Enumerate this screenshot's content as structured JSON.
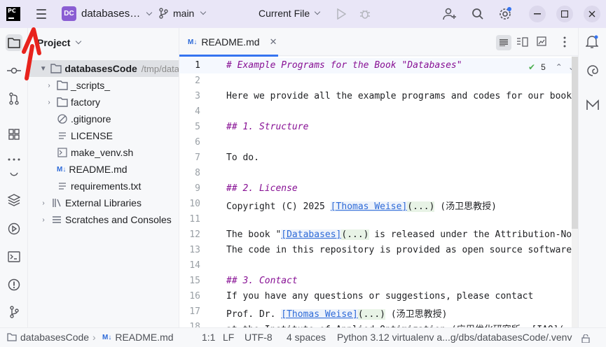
{
  "titlebar": {
    "logo_text": "PC",
    "project_badge": "DC",
    "project_name": "databases…",
    "branch": "main",
    "run_config": "Current File"
  },
  "project_panel": {
    "title": "Project",
    "root": {
      "name": "databasesCode",
      "path": "/tmp/data"
    },
    "items": [
      {
        "label": "_scripts_",
        "type": "folder"
      },
      {
        "label": "factory",
        "type": "folder"
      },
      {
        "label": ".gitignore",
        "type": "ignore"
      },
      {
        "label": "LICENSE",
        "type": "text"
      },
      {
        "label": "make_venv.sh",
        "type": "shell"
      },
      {
        "label": "README.md",
        "type": "markdown"
      },
      {
        "label": "requirements.txt",
        "type": "text"
      }
    ],
    "external_libraries": "External Libraries",
    "scratches": "Scratches and Consoles"
  },
  "editor": {
    "tab_label": "README.md",
    "tab_badge": "M↓",
    "inspection_count": "5",
    "line_numbers": [
      "1",
      "2",
      "3",
      "4",
      "5",
      "6",
      "7",
      "8",
      "9",
      "10",
      "11",
      "12",
      "13",
      "14",
      "15",
      "16",
      "17",
      "18"
    ],
    "lines": {
      "l1": "# Example Programs for the Book \"Databases\"",
      "l3": "Here we provide all the example programs and codes for our book",
      "l5": "## 1. Structure",
      "l7": "To do.",
      "l9": "## 2. License",
      "l10_a": "Copyright (C) 2025 ",
      "l10_link": "[Thomas Weise]",
      "l10_dots": "(...)",
      "l10_b": " (汤卫思教授)",
      "l12_a": "The book \"",
      "l12_link": "[Databases]",
      "l12_dots": "(...)",
      "l12_b": " is released under the Attribution-No",
      "l13": "The code in this repository is provided as open source software",
      "l15": "## 3. Contact",
      "l16": "If you have any questions or suggestions, please contact",
      "l17_a": "Prof. Dr. ",
      "l17_link": "[Thomas Weise]",
      "l17_dots": "(...)",
      "l17_b": " (汤卫思教授)",
      "l18": "at the Institute of Applied Optimization (应用优化研究所, [IAO]("
    }
  },
  "statusbar": {
    "project": "databasesCode",
    "file": "README.md",
    "file_badge": "M↓",
    "position": "1:1",
    "line_sep": "LF",
    "encoding": "UTF-8",
    "indent": "4 spaces",
    "interpreter": "Python 3.12 virtualenv a...g/dbs/databasesCode/.venv"
  },
  "colors": {
    "accent": "#3574f0",
    "titlebar_bg": "#e9e6f7",
    "annotation_arrow": "#e8231d"
  }
}
